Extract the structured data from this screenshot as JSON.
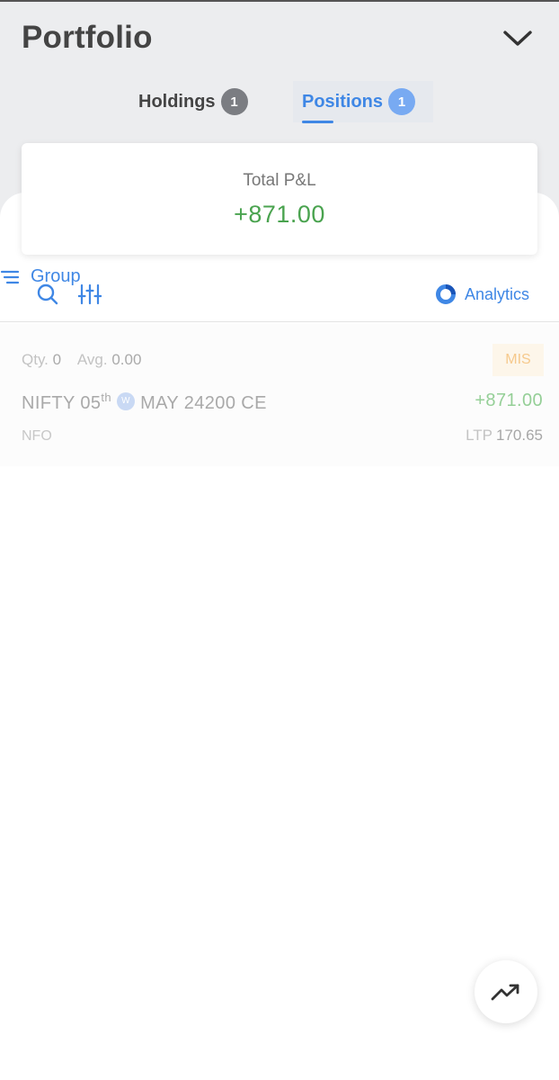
{
  "header": {
    "title": "Portfolio"
  },
  "tabs": [
    {
      "label": "Holdings",
      "count": "1",
      "active": false
    },
    {
      "label": "Positions",
      "count": "1",
      "active": true
    }
  ],
  "pnl_card": {
    "label": "Total P&L",
    "value": "+871.00"
  },
  "toolbar": {
    "group_label": "Group",
    "analytics_label": "Analytics"
  },
  "positions": [
    {
      "qty_label": "Qty.",
      "qty": "0",
      "avg_label": "Avg.",
      "avg": "0.00",
      "product": "MIS",
      "symbol_prefix": "NIFTY 05",
      "symbol_sup": "th",
      "weekly_badge": "W",
      "symbol_suffix": "MAY 24200 CE",
      "pnl": "+871.00",
      "exchange": "NFO",
      "ltp_label": "LTP",
      "ltp": "170.65"
    }
  ],
  "icons": {
    "collapse": "chevron-down-icon",
    "search": "search-icon",
    "filter": "sliders-icon",
    "group": "sort-lines-icon",
    "analytics": "analytics-ring-icon",
    "fab": "trending-up-icon"
  },
  "colors": {
    "accent": "#3f87e5",
    "profit": "#4aa34f",
    "header_bg": "#ecedef"
  }
}
